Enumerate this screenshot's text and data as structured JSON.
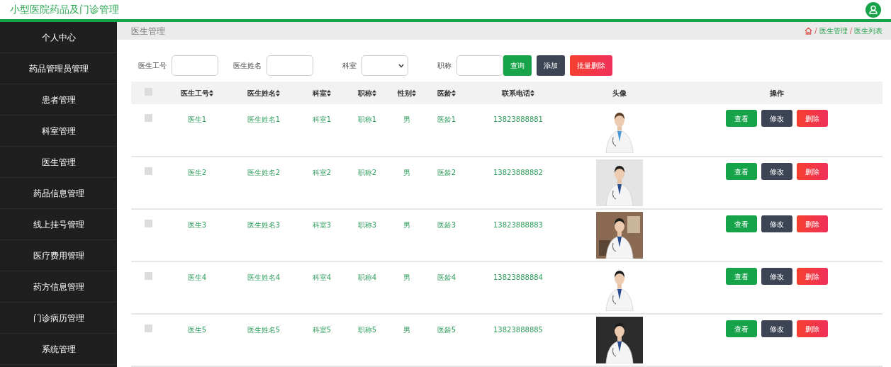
{
  "header": {
    "title": "小型医院药品及门诊管理"
  },
  "sidebar": {
    "items": [
      {
        "label": "个人中心",
        "selected": false
      },
      {
        "label": "药品管理员管理",
        "selected": false
      },
      {
        "label": "患者管理",
        "selected": false
      },
      {
        "label": "科室管理",
        "selected": false
      },
      {
        "label": "医生管理",
        "selected": false
      },
      {
        "label": "药品信息管理",
        "selected": false
      },
      {
        "label": "线上挂号管理",
        "selected": false
      },
      {
        "label": "医疗费用管理",
        "selected": false
      },
      {
        "label": "药方信息管理",
        "selected": false
      },
      {
        "label": "门诊病历管理",
        "selected": false
      },
      {
        "label": "系统管理",
        "selected": false
      }
    ]
  },
  "breadcrumb": {
    "page_title": "医生管理",
    "separator": "/",
    "trail": [
      "医生管理",
      "医生列表"
    ]
  },
  "search": {
    "fields": [
      {
        "label": "医生工号",
        "kind": "text"
      },
      {
        "label": "医生姓名",
        "kind": "text"
      },
      {
        "label": "科室",
        "kind": "select"
      },
      {
        "label": "职称",
        "kind": "text"
      }
    ],
    "buttons": [
      {
        "label": "查询",
        "kind": "query"
      },
      {
        "label": "添加",
        "kind": "add"
      },
      {
        "label": "批量删除",
        "kind": "delete"
      }
    ]
  },
  "table": {
    "header_checkbox": {
      "checked": false
    },
    "columns": [
      {
        "label": "医生工号",
        "sortable": true
      },
      {
        "label": "医生姓名",
        "sortable": true
      },
      {
        "label": "科室",
        "sortable": true
      },
      {
        "label": "职称",
        "sortable": true
      },
      {
        "label": "性别",
        "sortable": true
      },
      {
        "label": "医龄",
        "sortable": true
      },
      {
        "label": "联系电话",
        "sortable": true
      },
      {
        "label": "头像",
        "sortable": false
      },
      {
        "label": "操作",
        "sortable": false
      }
    ],
    "rows": [
      {
        "checked": false,
        "cells": [
          "医生1",
          "医生姓名1",
          "科室1",
          "职称1",
          "男",
          "医龄1",
          "13823888881"
        ],
        "avatar": {
          "kind": "picture"
        },
        "actions": [
          {
            "label": "查看",
            "kind": "view"
          },
          {
            "label": "修改",
            "kind": "edit"
          },
          {
            "label": "删除",
            "kind": "delete"
          }
        ]
      },
      {
        "checked": false,
        "cells": [
          "医生2",
          "医生姓名2",
          "科室2",
          "职称2",
          "男",
          "医龄2",
          "13823888882"
        ],
        "avatar": {
          "kind": "picture"
        },
        "actions": [
          {
            "label": "查看",
            "kind": "view"
          },
          {
            "label": "修改",
            "kind": "edit"
          },
          {
            "label": "删除",
            "kind": "delete"
          }
        ]
      },
      {
        "checked": false,
        "cells": [
          "医生3",
          "医生姓名3",
          "科室3",
          "职称3",
          "男",
          "医龄3",
          "13823888883"
        ],
        "avatar": {
          "kind": "picture"
        },
        "actions": [
          {
            "label": "查看",
            "kind": "view"
          },
          {
            "label": "修改",
            "kind": "edit"
          },
          {
            "label": "删除",
            "kind": "delete"
          }
        ]
      },
      {
        "checked": false,
        "cells": [
          "医生4",
          "医生姓名4",
          "科室4",
          "职称4",
          "男",
          "医龄4",
          "13823888884"
        ],
        "avatar": {
          "kind": "picture"
        },
        "actions": [
          {
            "label": "查看",
            "kind": "view"
          },
          {
            "label": "修改",
            "kind": "edit"
          },
          {
            "label": "删除",
            "kind": "delete"
          }
        ]
      },
      {
        "checked": false,
        "cells": [
          "医生5",
          "医生姓名5",
          "科室5",
          "职称5",
          "男",
          "医龄5",
          "13823888885"
        ],
        "avatar": {
          "kind": "picture"
        },
        "actions": [
          {
            "label": "查看",
            "kind": "view"
          },
          {
            "label": "修改",
            "kind": "edit"
          },
          {
            "label": "删除",
            "kind": "delete"
          }
        ]
      }
    ]
  }
}
